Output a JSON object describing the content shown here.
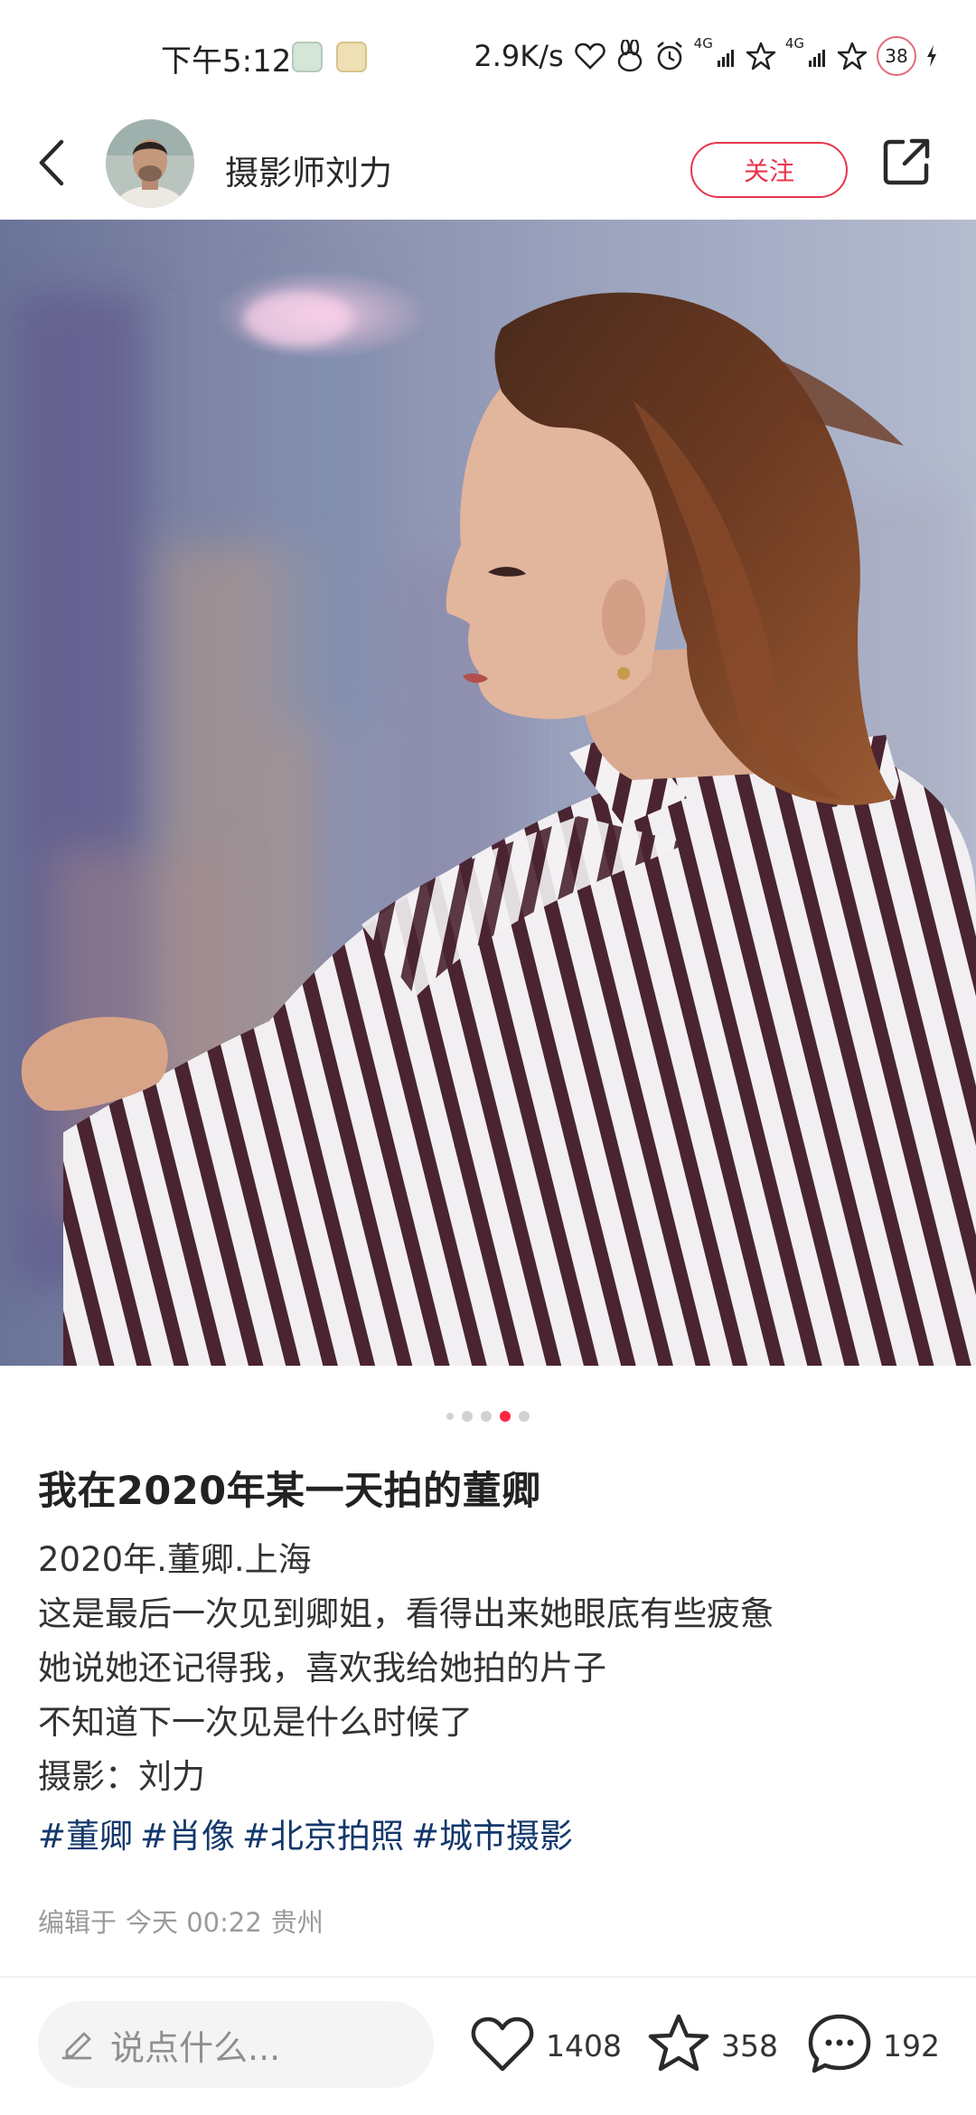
{
  "status_bar": {
    "time": "下午5:12",
    "net_speed": "2.9K/s",
    "signal1_label": "4G",
    "signal2_label": "4G",
    "battery": "38"
  },
  "header": {
    "author_name": "摄影师刘力",
    "follow_label": "关注"
  },
  "carousel": {
    "count": 5,
    "active_index": 3
  },
  "post": {
    "title": "我在2020年某一天拍的董卿",
    "body_lines": [
      "2020年.董卿.上海",
      "这是最后一次见到卿姐，看得出来她眼底有些疲惫",
      "她说她还记得我，喜欢我给她拍的片子",
      "不知道下一次见是什么时候了",
      "摄影：刘力"
    ],
    "tags": [
      "#董卿",
      "#肖像",
      "#北京拍照",
      "#城市摄影"
    ],
    "edit_label": "编辑于",
    "edit_time": "今天 00:22",
    "edit_location": "贵州"
  },
  "bottom_bar": {
    "comment_placeholder": "说点什么...",
    "likes": "1408",
    "collects": "358",
    "comments": "192"
  },
  "colors": {
    "accent": "#ff2442",
    "follow": "#e8364c",
    "tag": "#13386c",
    "muted": "#9a9a9a"
  },
  "icons": [
    "back-icon",
    "share-icon",
    "pen-icon",
    "heart-icon",
    "star-icon",
    "comment-icon",
    "alarm-icon",
    "rabbit-icon"
  ]
}
